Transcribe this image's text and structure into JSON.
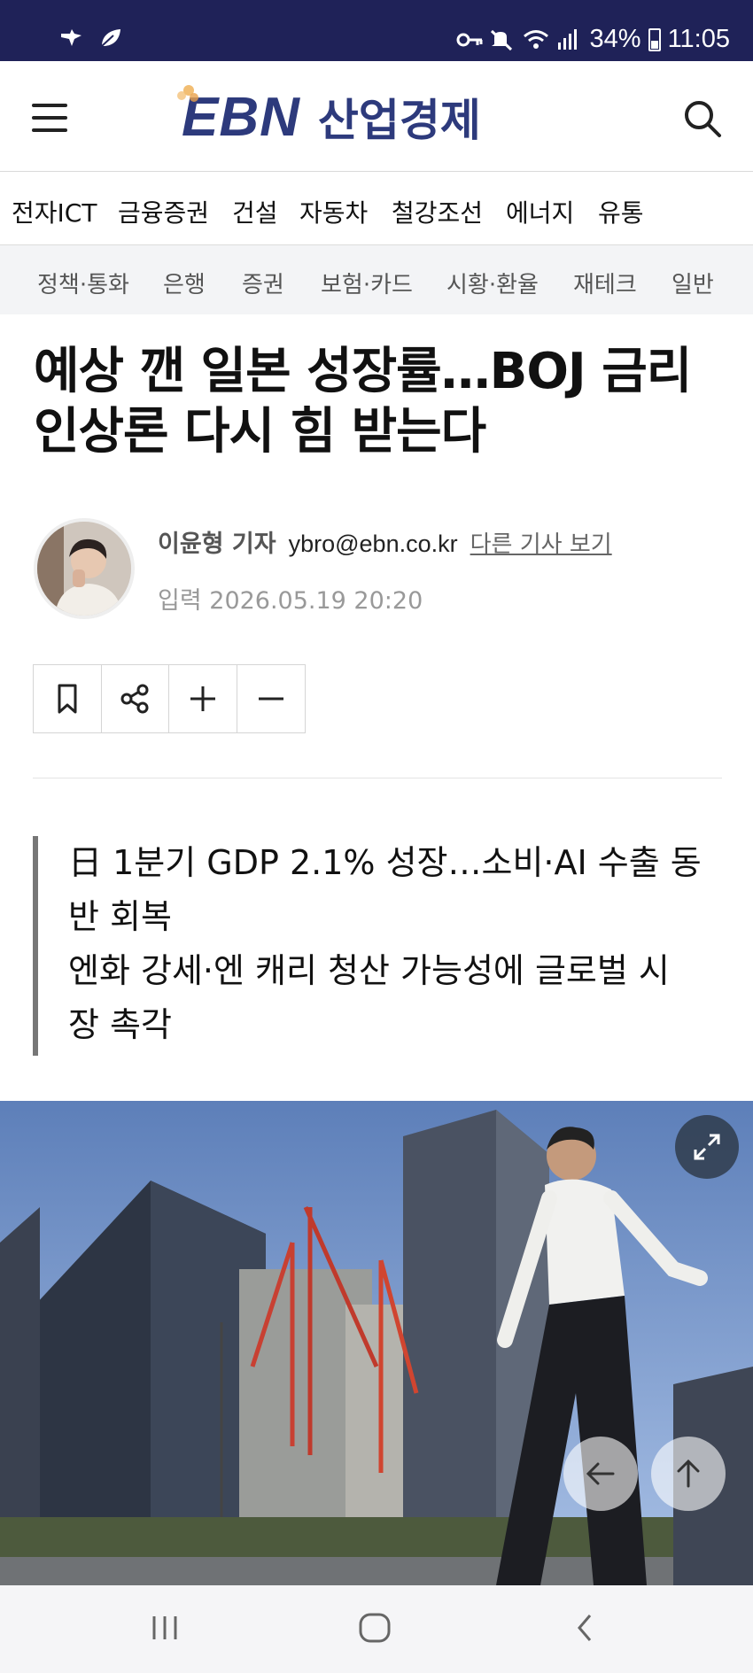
{
  "status_bar": {
    "battery": "34%",
    "time": "11:05",
    "left_icons": [
      "app-notification-icon",
      "leaf-icon"
    ],
    "right_icons": [
      "key-icon",
      "mute-icon",
      "wifi-icon",
      "signal-icon",
      "battery-icon"
    ]
  },
  "header": {
    "logo_latin": "EBN",
    "logo_korean": "산업경제"
  },
  "categories": [
    "전자ICT",
    "금융증권",
    "건설",
    "자동차",
    "철강조선",
    "에너지",
    "유통"
  ],
  "subcategories": [
    "정책·통화",
    "은행",
    "증권",
    "보험·카드",
    "시황·환율",
    "재테크",
    "일반"
  ],
  "article": {
    "headline_line1": "예상 깬 일본 성장률…BOJ 금리",
    "headline_line2": "인상론 다시 힘 받는다",
    "reporter": "이윤형 기자",
    "email": "ybro@ebn.co.kr",
    "more_articles": "다른 기사 보기",
    "date": "입력 2026.05.19 20:20",
    "summary": [
      "日 1분기 GDP 2.1% 성장…소비·AI 수출 동",
      "반 회복",
      "엔화 강세·엔 캐리 청산 가능성에 글로벌 시",
      "장 촉각"
    ]
  },
  "colors": {
    "status_bar": "#1f2258",
    "brand": "#2d3a7c",
    "subnav_bg": "#f3f4f6",
    "summary_border": "#777777"
  }
}
